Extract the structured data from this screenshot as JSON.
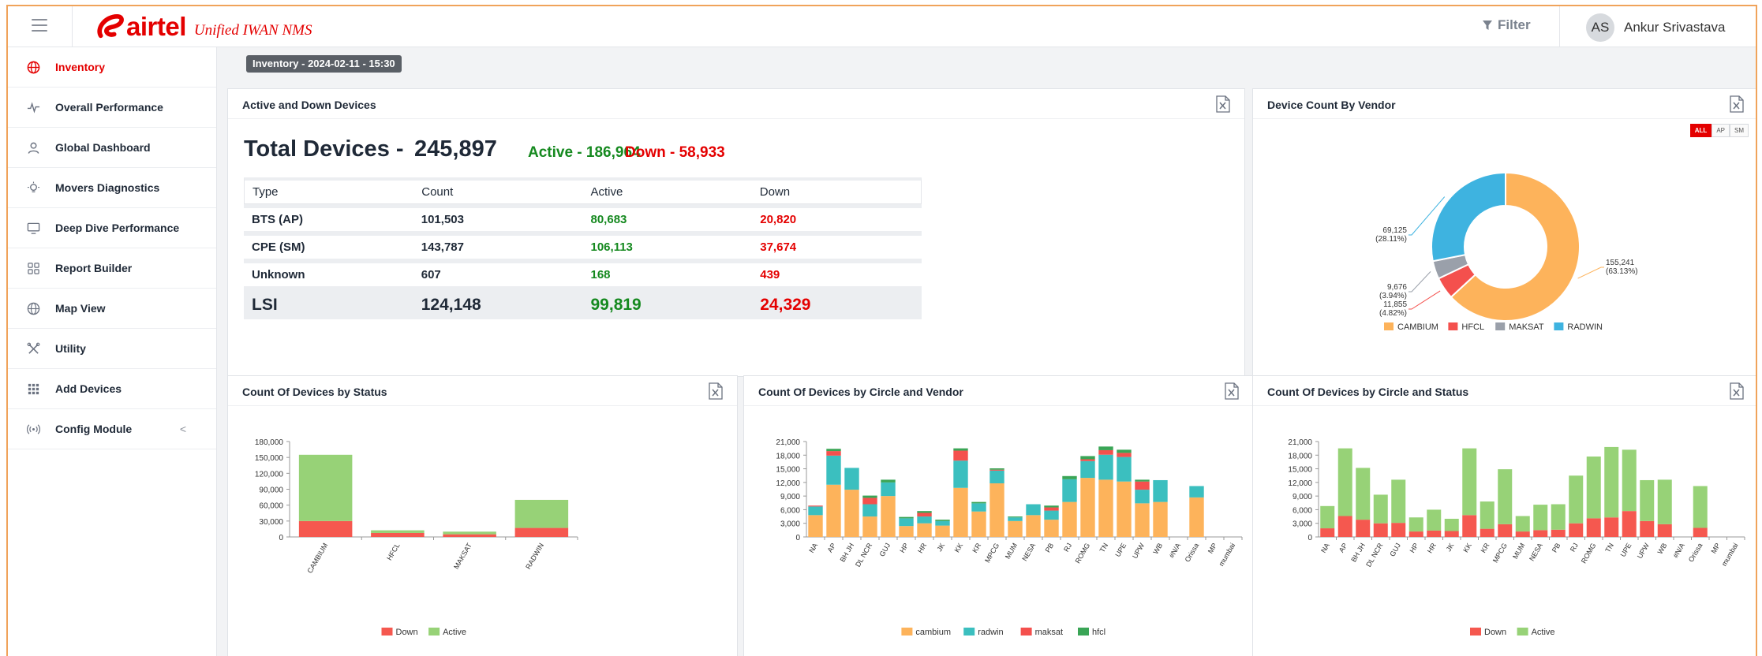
{
  "topbar": {
    "brand": "airtel",
    "tagline": "Unified IWAN NMS",
    "filter_label": "Filter",
    "user_initials": "AS",
    "user_name": "Ankur Srivastava"
  },
  "sidebar": {
    "items": [
      {
        "label": "Inventory",
        "icon": "globe-icon"
      },
      {
        "label": "Overall Performance",
        "icon": "pulse-icon"
      },
      {
        "label": "Global Dashboard",
        "icon": "user-icon"
      },
      {
        "label": "Movers Diagnostics",
        "icon": "bulb-icon"
      },
      {
        "label": "Deep Dive Performance",
        "icon": "monitor-icon"
      },
      {
        "label": "Report Builder",
        "icon": "grid-icon"
      },
      {
        "label": "Map View",
        "icon": "globe-icon"
      },
      {
        "label": "Utility",
        "icon": "tools-icon"
      },
      {
        "label": "Add Devices",
        "icon": "apps-icon"
      },
      {
        "label": "Config Module",
        "icon": "signal-icon"
      }
    ],
    "collapse_glyph": "<"
  },
  "breadcrumb": "Inventory - 2024-02-11 - 15:30",
  "panels": {
    "active_down": "Active and Down Devices",
    "vendor": "Device Count By Vendor",
    "status": "Count Of Devices by Status",
    "circle_vendor": "Count Of Devices by Circle and Vendor",
    "circle_status": "Count Of Devices by Circle and Status"
  },
  "summary": {
    "label": "Total Devices -",
    "total": "245,897",
    "active": "Active - 186,964",
    "down": "Down - 58,933"
  },
  "table": {
    "headers": [
      "Type",
      "Count",
      "Active",
      "Down"
    ],
    "rows": [
      [
        "BTS (AP)",
        "101,503",
        "80,683",
        "20,820"
      ],
      [
        "CPE (SM)",
        "143,787",
        "106,113",
        "37,674"
      ],
      [
        "Unknown",
        "607",
        "168",
        "439"
      ]
    ],
    "total_row": [
      "LSI",
      "124,148",
      "99,819",
      "24,329"
    ]
  },
  "vendor_toggle": [
    "ALL",
    "AP",
    "SM"
  ],
  "colors": {
    "red": "#e40000",
    "green": "#15891f",
    "cambium": "#fdb35b",
    "hfcl": "#f4504d",
    "maksat": "#9aa0aa",
    "radwin": "#3eb3e0",
    "active": "#97d277",
    "down": "#f5584f",
    "teal": "#3bbfbf",
    "hfcl_green": "#3aa556"
  },
  "chart_data": [
    {
      "type": "pie",
      "title": "Device Count By Vendor",
      "labels": [
        "CAMBIUM",
        "HFCL",
        "MAKSAT",
        "RADWIN"
      ],
      "values": [
        155241,
        11855,
        9676,
        69125
      ],
      "value_labels": [
        "155,241",
        "11,855",
        "9,676",
        "69,125"
      ],
      "percent_labels": [
        "(63.13%)",
        "(4.82%)",
        "(3.94%)",
        "(28.11%)"
      ],
      "legend": "bottom"
    },
    {
      "type": "bar",
      "title": "Count Of Devices by Status",
      "categories": [
        "CAMBIUM",
        "HFCL",
        "MAKSAT",
        "RADWIN"
      ],
      "series": [
        {
          "name": "Down",
          "values": [
            30000,
            7500,
            5000,
            17000
          ]
        },
        {
          "name": "Active",
          "values": [
            125000,
            5000,
            5000,
            53000
          ]
        }
      ],
      "ylim": [
        0,
        180000
      ],
      "yticks": [
        "0",
        "30,000",
        "60,000",
        "90,000",
        "120,000",
        "150,000",
        "180,000"
      ],
      "legend": "bottom"
    },
    {
      "type": "bar",
      "title": "Count Of Devices by Circle and Vendor",
      "categories": [
        "NA",
        "AP",
        "BH JH",
        "DL NCR",
        "GUJ",
        "HP",
        "HR",
        "JK",
        "KK",
        "KR",
        "MPCG",
        "MUM",
        "NESA",
        "PB",
        "RJ",
        "ROMG",
        "TN",
        "UPE",
        "UPW",
        "WB",
        "#N/A",
        "Orissa",
        "MP",
        "mumbai"
      ],
      "series": [
        {
          "name": "cambium",
          "values": [
            4800,
            11500,
            10400,
            4500,
            9000,
            2400,
            3000,
            2500,
            10800,
            5600,
            11800,
            3500,
            4800,
            3800,
            7700,
            13000,
            12600,
            12200,
            7400,
            7700,
            0,
            8700,
            0,
            0
          ]
        },
        {
          "name": "radwin",
          "values": [
            1900,
            6400,
            4800,
            2700,
            3000,
            1700,
            1500,
            1000,
            6000,
            1800,
            2800,
            800,
            2400,
            2000,
            5000,
            3700,
            5500,
            5400,
            3000,
            4800,
            0,
            2500,
            0,
            0
          ]
        },
        {
          "name": "maksat",
          "values": [
            200,
            1000,
            0,
            1400,
            0,
            0,
            800,
            0,
            2200,
            0,
            200,
            0,
            0,
            700,
            0,
            400,
            1000,
            900,
            1800,
            0,
            0,
            0,
            0,
            0
          ]
        },
        {
          "name": "hfcl",
          "values": [
            0,
            500,
            0,
            500,
            600,
            300,
            400,
            300,
            500,
            300,
            300,
            200,
            0,
            400,
            700,
            700,
            800,
            700,
            400,
            0,
            0,
            0,
            0,
            0
          ]
        }
      ],
      "ylim": [
        0,
        21000
      ],
      "yticks": [
        "0",
        "3,000",
        "6,000",
        "9,000",
        "12,000",
        "15,000",
        "18,000",
        "21,000"
      ],
      "legend": "bottom"
    },
    {
      "type": "bar",
      "title": "Count Of Devices by Circle and Status",
      "categories": [
        "NA",
        "AP",
        "BH JH",
        "DL NCR",
        "GUJ",
        "HP",
        "HR",
        "JK",
        "KK",
        "KR",
        "MPCG",
        "MUM",
        "NESA",
        "PB",
        "RJ",
        "ROMG",
        "TN",
        "UPE",
        "UPW",
        "WB",
        "#N/A",
        "Orissa",
        "MP",
        "mumbai"
      ],
      "series": [
        {
          "name": "Down",
          "values": [
            1900,
            4600,
            3800,
            3000,
            3100,
            1200,
            1400,
            1300,
            4800,
            1800,
            2800,
            1200,
            1500,
            1600,
            3000,
            4100,
            4300,
            5700,
            3500,
            2800,
            0,
            2000,
            0,
            0
          ]
        },
        {
          "name": "Active",
          "values": [
            4900,
            14900,
            11400,
            6300,
            9500,
            3100,
            4600,
            2700,
            14700,
            6000,
            12100,
            3400,
            5600,
            5600,
            10500,
            13600,
            15500,
            13500,
            9000,
            9800,
            0,
            9200,
            0,
            0
          ]
        }
      ],
      "ylim": [
        0,
        21000
      ],
      "yticks": [
        "0",
        "3,000",
        "6,000",
        "9,000",
        "12,000",
        "15,000",
        "18,000",
        "21,000"
      ],
      "legend": "bottom"
    }
  ]
}
